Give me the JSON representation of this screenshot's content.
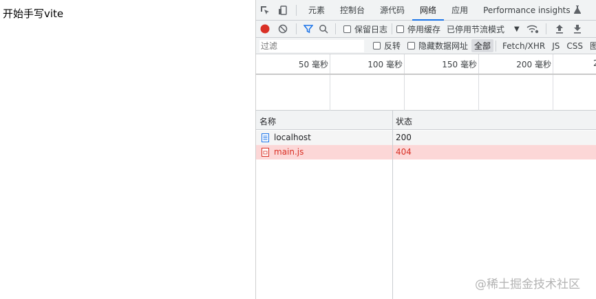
{
  "page": {
    "heading": "开始手写vite"
  },
  "devtools": {
    "tabs": [
      {
        "label": "元素"
      },
      {
        "label": "控制台"
      },
      {
        "label": "源代码"
      },
      {
        "label": "网络"
      },
      {
        "label": "应用"
      },
      {
        "label": "Performance insights"
      }
    ],
    "active_tab": "网络",
    "toolbar": {
      "preserve_log": "保留日志",
      "disable_cache": "停用缓存",
      "throttle": "已停用节流模式"
    },
    "filter": {
      "placeholder": "过滤",
      "invert": "反转",
      "hide_data_urls": "隐藏数据网址",
      "types": [
        "全部",
        "Fetch/XHR",
        "JS",
        "CSS",
        "图"
      ]
    },
    "timeline": {
      "ticks": [
        "50 毫秒",
        "100 毫秒",
        "150 毫秒",
        "200 毫秒",
        "2"
      ]
    },
    "table": {
      "columns": {
        "name": "名称",
        "status": "状态"
      },
      "rows": [
        {
          "name": "localhost",
          "status": "200",
          "type": "document",
          "error": false
        },
        {
          "name": "main.js",
          "status": "404",
          "type": "script",
          "error": true
        }
      ]
    }
  },
  "watermark": "@稀土掘金技术社区",
  "colors": {
    "accent": "#1a73e8",
    "record": "#d93025",
    "error_row": "#fcd7d7",
    "error_text": "#d93025"
  }
}
